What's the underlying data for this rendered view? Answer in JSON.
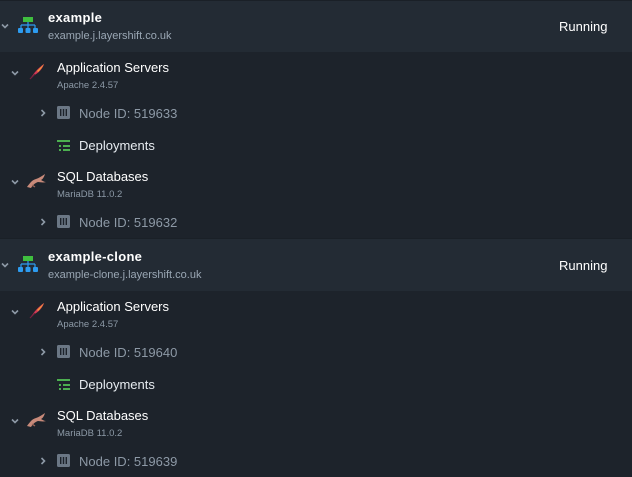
{
  "environments": [
    {
      "name": "example",
      "domain": "example.j.layershift.co.uk",
      "status": "Running",
      "app_servers": {
        "title": "Application Servers",
        "version": "Apache 2.4.57",
        "node_label": "Node ID: 519633",
        "deployments_label": "Deployments"
      },
      "sql_databases": {
        "title": "SQL Databases",
        "version": "MariaDB 11.0.2",
        "node_label": "Node ID: 519632"
      }
    },
    {
      "name": "example-clone",
      "domain": "example-clone.j.layershift.co.uk",
      "status": "Running",
      "app_servers": {
        "title": "Application Servers",
        "version": "Apache 2.4.57",
        "node_label": "Node ID: 519640",
        "deployments_label": "Deployments"
      },
      "sql_databases": {
        "title": "SQL Databases",
        "version": "MariaDB 11.0.2",
        "node_label": "Node ID: 519639"
      }
    }
  ],
  "colors": {
    "background": "#1d232b",
    "env_row": "#232b34",
    "topology_green": "#3fbf3f",
    "topology_blue": "#2d9cf0",
    "deploy_green": "#4caf50",
    "node_icon": "#6b7785"
  },
  "icons": {
    "environment": "topology-icon",
    "app_server": "apache-feather-icon",
    "database": "mariadb-seal-icon",
    "node": "server-node-icon",
    "deployments": "deployments-list-icon",
    "expand": "chevron-down-icon",
    "collapsed": "chevron-right-icon"
  }
}
